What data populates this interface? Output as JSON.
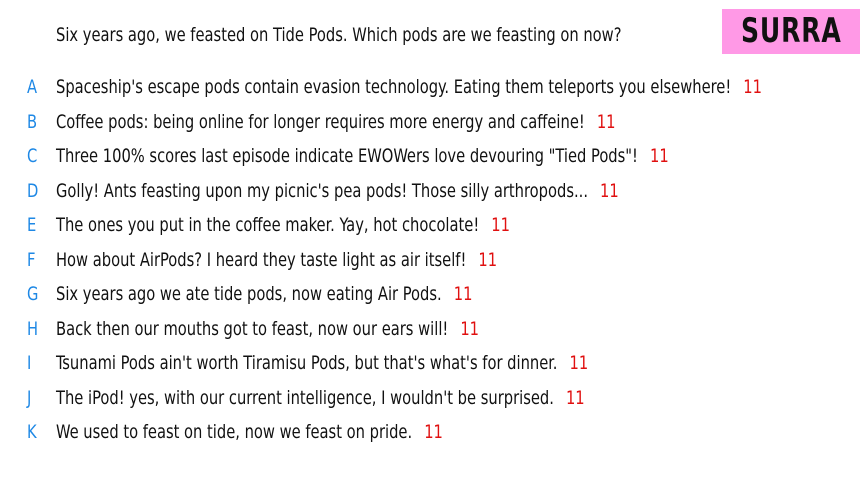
{
  "prompt": "Six years ago, we feasted on Tide Pods. Which pods are we feasting on now?",
  "badge": {
    "text": "SURRA",
    "color": "#ff99e6"
  },
  "colors": {
    "letter": "#1e88e5",
    "score": "#e01010",
    "text": "#111111"
  },
  "entries": [
    {
      "letter": "A",
      "text": "Spaceship's escape pods contain evasion technology. Eating them teleports you elsewhere!",
      "score": "11"
    },
    {
      "letter": "B",
      "text": "Coffee pods: being online for longer requires more energy and caffeine!",
      "score": "11"
    },
    {
      "letter": "C",
      "text": "Three 100% scores last episode indicate EWOWers love devouring \"Tied Pods\"!",
      "score": "11"
    },
    {
      "letter": "D",
      "text": "Golly! Ants feasting upon my picnic's pea pods! Those silly arthropods...",
      "score": "11"
    },
    {
      "letter": "E",
      "text": "The ones you put in the coffee maker. Yay, hot chocolate!",
      "score": "11"
    },
    {
      "letter": "F",
      "text": "How about AirPods? I heard they taste light as air itself!",
      "score": "11"
    },
    {
      "letter": "G",
      "text": "Six years ago we ate tide pods, now eating Air Pods.",
      "score": "11"
    },
    {
      "letter": "H",
      "text": "Back then our mouths got to feast, now our ears will!",
      "score": "11"
    },
    {
      "letter": "I",
      "text": "Tsunami Pods ain't worth Tiramisu Pods, but that's what's for dinner.",
      "score": "11"
    },
    {
      "letter": "J",
      "text": "The iPod! yes, with our current intelligence, I wouldn't be surprised.",
      "score": "11"
    },
    {
      "letter": "K",
      "text": "We used to feast on tide, now we feast on pride.",
      "score": "11"
    }
  ]
}
